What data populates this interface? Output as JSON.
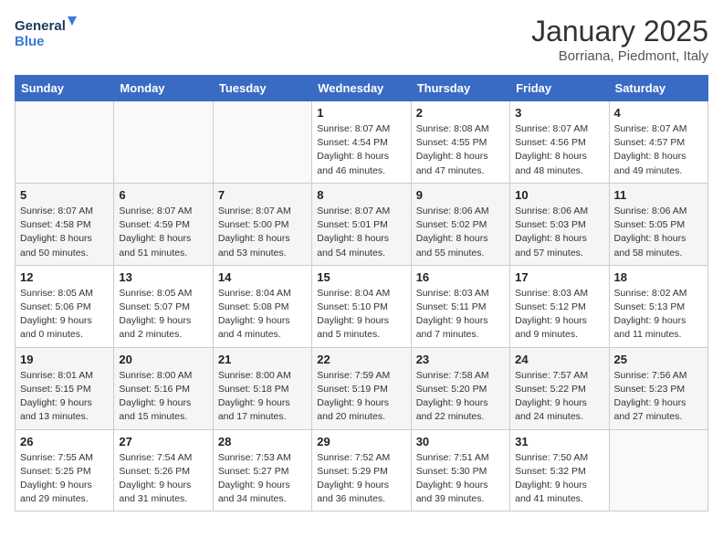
{
  "logo": {
    "line1": "General",
    "line2": "Blue"
  },
  "title": "January 2025",
  "subtitle": "Borriana, Piedmont, Italy",
  "days_of_week": [
    "Sunday",
    "Monday",
    "Tuesday",
    "Wednesday",
    "Thursday",
    "Friday",
    "Saturday"
  ],
  "weeks": [
    [
      {
        "day": "",
        "info": ""
      },
      {
        "day": "",
        "info": ""
      },
      {
        "day": "",
        "info": ""
      },
      {
        "day": "1",
        "info": "Sunrise: 8:07 AM\nSunset: 4:54 PM\nDaylight: 8 hours\nand 46 minutes."
      },
      {
        "day": "2",
        "info": "Sunrise: 8:08 AM\nSunset: 4:55 PM\nDaylight: 8 hours\nand 47 minutes."
      },
      {
        "day": "3",
        "info": "Sunrise: 8:07 AM\nSunset: 4:56 PM\nDaylight: 8 hours\nand 48 minutes."
      },
      {
        "day": "4",
        "info": "Sunrise: 8:07 AM\nSunset: 4:57 PM\nDaylight: 8 hours\nand 49 minutes."
      }
    ],
    [
      {
        "day": "5",
        "info": "Sunrise: 8:07 AM\nSunset: 4:58 PM\nDaylight: 8 hours\nand 50 minutes."
      },
      {
        "day": "6",
        "info": "Sunrise: 8:07 AM\nSunset: 4:59 PM\nDaylight: 8 hours\nand 51 minutes."
      },
      {
        "day": "7",
        "info": "Sunrise: 8:07 AM\nSunset: 5:00 PM\nDaylight: 8 hours\nand 53 minutes."
      },
      {
        "day": "8",
        "info": "Sunrise: 8:07 AM\nSunset: 5:01 PM\nDaylight: 8 hours\nand 54 minutes."
      },
      {
        "day": "9",
        "info": "Sunrise: 8:06 AM\nSunset: 5:02 PM\nDaylight: 8 hours\nand 55 minutes."
      },
      {
        "day": "10",
        "info": "Sunrise: 8:06 AM\nSunset: 5:03 PM\nDaylight: 8 hours\nand 57 minutes."
      },
      {
        "day": "11",
        "info": "Sunrise: 8:06 AM\nSunset: 5:05 PM\nDaylight: 8 hours\nand 58 minutes."
      }
    ],
    [
      {
        "day": "12",
        "info": "Sunrise: 8:05 AM\nSunset: 5:06 PM\nDaylight: 9 hours\nand 0 minutes."
      },
      {
        "day": "13",
        "info": "Sunrise: 8:05 AM\nSunset: 5:07 PM\nDaylight: 9 hours\nand 2 minutes."
      },
      {
        "day": "14",
        "info": "Sunrise: 8:04 AM\nSunset: 5:08 PM\nDaylight: 9 hours\nand 4 minutes."
      },
      {
        "day": "15",
        "info": "Sunrise: 8:04 AM\nSunset: 5:10 PM\nDaylight: 9 hours\nand 5 minutes."
      },
      {
        "day": "16",
        "info": "Sunrise: 8:03 AM\nSunset: 5:11 PM\nDaylight: 9 hours\nand 7 minutes."
      },
      {
        "day": "17",
        "info": "Sunrise: 8:03 AM\nSunset: 5:12 PM\nDaylight: 9 hours\nand 9 minutes."
      },
      {
        "day": "18",
        "info": "Sunrise: 8:02 AM\nSunset: 5:13 PM\nDaylight: 9 hours\nand 11 minutes."
      }
    ],
    [
      {
        "day": "19",
        "info": "Sunrise: 8:01 AM\nSunset: 5:15 PM\nDaylight: 9 hours\nand 13 minutes."
      },
      {
        "day": "20",
        "info": "Sunrise: 8:00 AM\nSunset: 5:16 PM\nDaylight: 9 hours\nand 15 minutes."
      },
      {
        "day": "21",
        "info": "Sunrise: 8:00 AM\nSunset: 5:18 PM\nDaylight: 9 hours\nand 17 minutes."
      },
      {
        "day": "22",
        "info": "Sunrise: 7:59 AM\nSunset: 5:19 PM\nDaylight: 9 hours\nand 20 minutes."
      },
      {
        "day": "23",
        "info": "Sunrise: 7:58 AM\nSunset: 5:20 PM\nDaylight: 9 hours\nand 22 minutes."
      },
      {
        "day": "24",
        "info": "Sunrise: 7:57 AM\nSunset: 5:22 PM\nDaylight: 9 hours\nand 24 minutes."
      },
      {
        "day": "25",
        "info": "Sunrise: 7:56 AM\nSunset: 5:23 PM\nDaylight: 9 hours\nand 27 minutes."
      }
    ],
    [
      {
        "day": "26",
        "info": "Sunrise: 7:55 AM\nSunset: 5:25 PM\nDaylight: 9 hours\nand 29 minutes."
      },
      {
        "day": "27",
        "info": "Sunrise: 7:54 AM\nSunset: 5:26 PM\nDaylight: 9 hours\nand 31 minutes."
      },
      {
        "day": "28",
        "info": "Sunrise: 7:53 AM\nSunset: 5:27 PM\nDaylight: 9 hours\nand 34 minutes."
      },
      {
        "day": "29",
        "info": "Sunrise: 7:52 AM\nSunset: 5:29 PM\nDaylight: 9 hours\nand 36 minutes."
      },
      {
        "day": "30",
        "info": "Sunrise: 7:51 AM\nSunset: 5:30 PM\nDaylight: 9 hours\nand 39 minutes."
      },
      {
        "day": "31",
        "info": "Sunrise: 7:50 AM\nSunset: 5:32 PM\nDaylight: 9 hours\nand 41 minutes."
      },
      {
        "day": "",
        "info": ""
      }
    ]
  ]
}
